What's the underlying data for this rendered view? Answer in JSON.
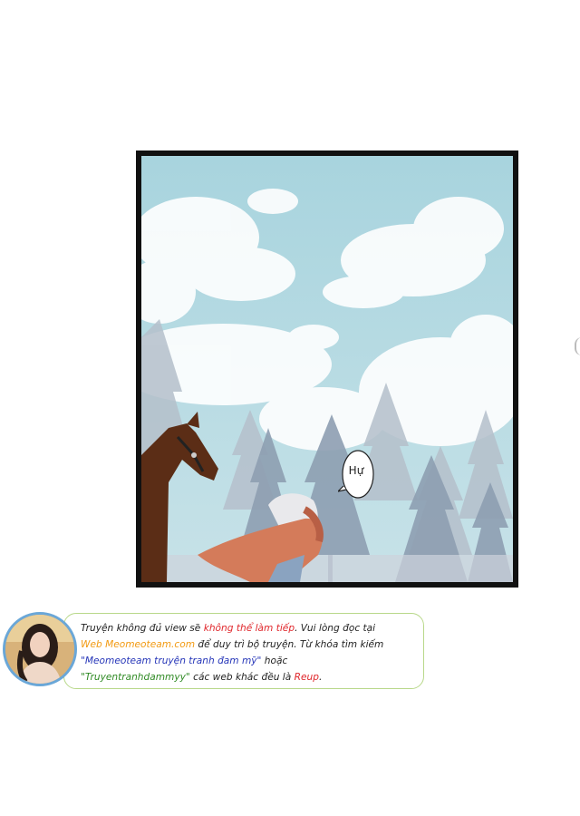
{
  "bubble": {
    "text": "Hự"
  },
  "notice": {
    "line1_a": "Truyện không đủ view sẽ ",
    "line1_b": "không thể làm tiếp",
    "line1_c": ". Vui lòng đọc tại",
    "line2_a": "Web Meomeoteam.com",
    "line2_b": " để duy trì bộ truyện. Từ khóa tìm kiếm",
    "line3_a": "\"Meomeoteam truyện tranh đam mỹ\"",
    "line3_b": " hoặc",
    "line4_a": "\"Truyentranhdammyy\"",
    "line4_b": " các web khác đều là ",
    "line4_c": "Reup",
    "line4_d": "."
  },
  "colors": {
    "warning": "#e0262b",
    "site": "#f29a12",
    "keyword1": "#2535b8",
    "keyword2": "#2f8a24",
    "border": "#b8d88a"
  }
}
